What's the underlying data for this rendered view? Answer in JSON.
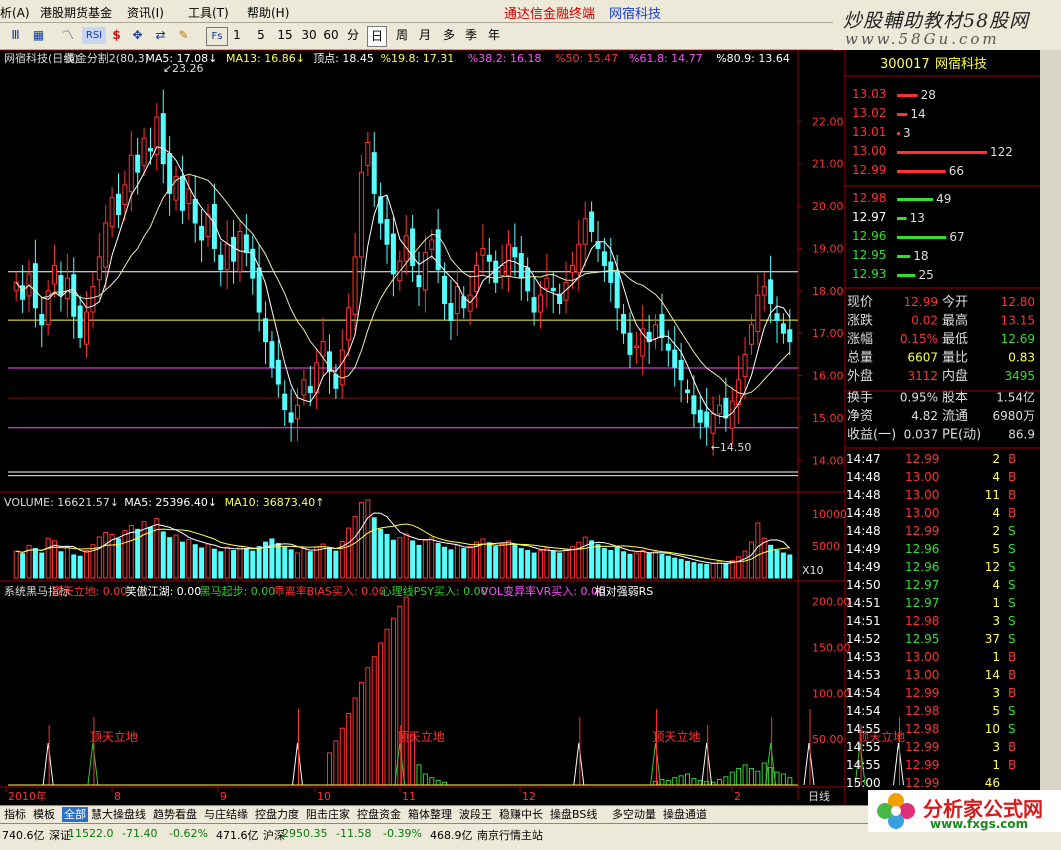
{
  "menu": [
    "析(A)",
    "港股期货基金",
    "资讯(I)",
    "工具(T)",
    "帮助(H)"
  ],
  "promo": {
    "broker": "通达信金融终端",
    "stock": "网宿科技"
  },
  "watermark": {
    "title": "炒股輔助教材58股网",
    "url": "www.58Gu.com"
  },
  "toolbar": {
    "icons": [
      "Ⅲ",
      "RSI",
      "$",
      "✥",
      "⇄",
      "✎",
      "Fs"
    ],
    "periods": [
      "1",
      "5",
      "15",
      "30",
      "60",
      "分"
    ],
    "period_tabs": [
      "日",
      "周",
      "月",
      "多",
      "季",
      "年"
    ],
    "selected_period": "日"
  },
  "main_header": {
    "name": "网宿科技(日线)",
    "indicator": "黄金分割2(80,3)",
    "ma5": "MA5: 17.08",
    "ma13": "MA13: 16.86",
    "peak": "顶点: 18.45",
    "levels": [
      "%19.8: 17.31",
      "%38.2: 16.18",
      "%50: 15.47",
      "%61.8: 14.77",
      "%80.9: 13.64"
    ],
    "high_label": "23.26",
    "low_label": "14.50"
  },
  "vol_header": {
    "volume": "VOLUME: 16621.57",
    "ma5": "MA5: 25396.40",
    "ma10": "MA10: 36873.40"
  },
  "ind_header": {
    "name": "系统黑马指标",
    "items": [
      "顶天立地: 0.00",
      "笑傲江湖: 0.00",
      "黑马起步: 0.00",
      "乖离率BIAS买入: 0.00",
      "心理线PSY买入: 0.00",
      "VOL变异率VR买入: 0.00",
      "相对强弱RS"
    ]
  },
  "signal_label": "顶天立地",
  "x_axis": [
    "2010年",
    "8",
    "9",
    "10",
    "11",
    "12",
    "2",
    "日线"
  ],
  "price_axis": [
    "22.00",
    "21.00",
    "20.00",
    "19.00",
    "18.00",
    "17.00",
    "16.00",
    "15.00",
    "14.00"
  ],
  "vol_axis": [
    "10000",
    "5000"
  ],
  "vol_unit": "X10",
  "ind_axis": [
    "200.00",
    "150.00",
    "100.00",
    "50.00"
  ],
  "quote": {
    "code": "300017",
    "name": "网宿科技",
    "asks": [
      {
        "price": "13.03",
        "vol": "28"
      },
      {
        "price": "13.02",
        "vol": "14"
      },
      {
        "price": "13.01",
        "vol": "3"
      },
      {
        "price": "13.00",
        "vol": "122"
      },
      {
        "price": "12.99",
        "vol": "66"
      }
    ],
    "bids": [
      {
        "price": "12.98",
        "vol": "49"
      },
      {
        "price": "12.97",
        "vol": "13"
      },
      {
        "price": "12.96",
        "vol": "67"
      },
      {
        "price": "12.95",
        "vol": "18"
      },
      {
        "price": "12.93",
        "vol": "25"
      }
    ],
    "stats": [
      {
        "l1": "现价",
        "v1": "12.99",
        "l2": "今开",
        "v2": "12.80"
      },
      {
        "l1": "涨跌",
        "v1": "0.02",
        "l2": "最高",
        "v2": "13.15"
      },
      {
        "l1": "涨幅",
        "v1": "0.15%",
        "l2": "最低",
        "v2": "12.69"
      },
      {
        "l1": "总量",
        "v1": "6607",
        "l2": "量比",
        "v2": "0.83"
      },
      {
        "l1": "外盘",
        "v1": "3112",
        "l2": "内盘",
        "v2": "3495"
      },
      {
        "l1": "换手",
        "v1": "0.95%",
        "l2": "股本",
        "v2": "1.54亿"
      },
      {
        "l1": "净资",
        "v1": "4.82",
        "l2": "流通",
        "v2": "6980万"
      },
      {
        "l1": "收益(一)",
        "v1": "0.037",
        "l2": "PE(动)",
        "v2": "86.9"
      }
    ],
    "ticks": [
      {
        "time": "14:47",
        "price": "12.99",
        "vol": "2",
        "bs": "B"
      },
      {
        "time": "14:48",
        "price": "13.00",
        "vol": "4",
        "bs": "B"
      },
      {
        "time": "14:48",
        "price": "13.00",
        "vol": "11",
        "bs": "B"
      },
      {
        "time": "14:48",
        "price": "13.00",
        "vol": "4",
        "bs": "B"
      },
      {
        "time": "14:48",
        "price": "12.99",
        "vol": "2",
        "bs": "S"
      },
      {
        "time": "14:49",
        "price": "12.96",
        "vol": "5",
        "bs": "S"
      },
      {
        "time": "14:49",
        "price": "12.96",
        "vol": "12",
        "bs": "S"
      },
      {
        "time": "14:50",
        "price": "12.97",
        "vol": "4",
        "bs": "S"
      },
      {
        "time": "14:51",
        "price": "12.97",
        "vol": "1",
        "bs": "S"
      },
      {
        "time": "14:51",
        "price": "12.98",
        "vol": "3",
        "bs": "S"
      },
      {
        "time": "14:52",
        "price": "12.95",
        "vol": "37",
        "bs": "S"
      },
      {
        "time": "14:53",
        "price": "13.00",
        "vol": "1",
        "bs": "B"
      },
      {
        "time": "14:53",
        "price": "13.00",
        "vol": "14",
        "bs": "B"
      },
      {
        "time": "14:54",
        "price": "12.99",
        "vol": "3",
        "bs": "B"
      },
      {
        "time": "14:54",
        "price": "12.98",
        "vol": "5",
        "bs": "S"
      },
      {
        "time": "14:55",
        "price": "12.98",
        "vol": "10",
        "bs": "S"
      },
      {
        "time": "14:55",
        "price": "12.99",
        "vol": "3",
        "bs": "B"
      },
      {
        "time": "14:55",
        "price": "12.99",
        "vol": "1",
        "bs": "B"
      },
      {
        "time": "15:00",
        "price": "12.99",
        "vol": "46",
        "bs": ""
      }
    ]
  },
  "bottom_tabs": [
    "指标",
    "模板",
    "全部",
    "慧大操盘线",
    "趋势看盘",
    "与庄结缘",
    "控盘力度",
    "阻击庄家",
    "控盘资金",
    "箱体整理",
    "波段王",
    "稳赚中长",
    "操盘BS线",
    "多空动量",
    "操盘通道"
  ],
  "selected_tab": "全部",
  "status": [
    {
      "text": "740.6亿",
      "color": "#000000"
    },
    {
      "text": "深证",
      "color": "#000000"
    },
    {
      "text": "11522.0",
      "color": "#0a7a0a"
    },
    {
      "text": "-71.40",
      "color": "#0a7a0a"
    },
    {
      "text": "-0.62%",
      "color": "#0a7a0a"
    },
    {
      "text": "471.6亿",
      "color": "#000000"
    },
    {
      "text": "沪深",
      "color": "#000000"
    },
    {
      "text": "2950.35",
      "color": "#0a7a0a"
    },
    {
      "text": "-11.58",
      "color": "#0a7a0a"
    },
    {
      "text": "-0.39%",
      "color": "#0a7a0a"
    },
    {
      "text": "468.9亿",
      "color": "#000000"
    },
    {
      "text": "南京行情主站",
      "color": "#000000"
    }
  ],
  "logo": {
    "title": "分析家公式网",
    "url": "www.fxgs.com"
  },
  "colors": {
    "up": "#ff3232",
    "down": "#54ffff",
    "gold": "#ffff50",
    "purple": "#ff50ff",
    "grid": "#a00000",
    "ma5": "#ffffff",
    "ma13": "#ffff00",
    "green": "#30d030"
  },
  "chart_data": [
    {
      "type": "candlestick",
      "title": "网宿科技(日线)",
      "x_labels": [
        "2010年",
        "8",
        "9",
        "10",
        "11",
        "12",
        "2"
      ],
      "ylim": [
        13.3,
        23.4
      ],
      "fib_levels": [
        18.45,
        17.31,
        16.18,
        15.47,
        14.77,
        13.64
      ],
      "marked_high": 23.26,
      "marked_low": 14.5,
      "closes": [
        18.2,
        17.8,
        18.4,
        17.6,
        17.2,
        18.0,
        18.6,
        17.9,
        18.3,
        17.4,
        16.9,
        17.5,
        18.1,
        18.8,
        19.6,
        20.2,
        19.8,
        20.5,
        21.2,
        20.8,
        21.6,
        21.3,
        22.1,
        21.0,
        20.3,
        20.7,
        19.9,
        20.4,
        19.6,
        19.2,
        19.8,
        19.0,
        18.5,
        19.1,
        18.7,
        19.4,
        18.9,
        18.3,
        17.5,
        16.8,
        16.2,
        15.8,
        15.2,
        14.9,
        15.3,
        15.9,
        15.6,
        16.3,
        16.8,
        16.1,
        15.7,
        16.6,
        17.6,
        18.8,
        20.8,
        21.5,
        20.3,
        19.6,
        19.1,
        18.4,
        18.7,
        19.3,
        18.6,
        18.1,
        18.9,
        19.2,
        18.5,
        17.7,
        17.3,
        18.1,
        17.6,
        17.9,
        18.6,
        19.0,
        18.7,
        18.2,
        18.6,
        19.1,
        18.8,
        18.3,
        18.0,
        17.5,
        17.9,
        18.3,
        18.0,
        17.7,
        18.2,
        18.6,
        19.1,
        19.7,
        19.4,
        19.0,
        18.6,
        18.2,
        17.6,
        17.0,
        16.5,
        16.7,
        17.1,
        16.8,
        17.2,
        16.9,
        16.6,
        16.2,
        15.9,
        15.6,
        15.1,
        14.9,
        14.8,
        15.1,
        15.3,
        15.0,
        15.4,
        15.9,
        16.5,
        17.2,
        17.9,
        18.1,
        17.7,
        17.3,
        17.0,
        16.8
      ]
    },
    {
      "type": "bar",
      "title": "VOLUME",
      "unit": "X10",
      "ylim": [
        0,
        12500
      ],
      "values": [
        4200,
        3800,
        5100,
        4600,
        3900,
        6200,
        5800,
        4100,
        4800,
        3600,
        3400,
        4300,
        5200,
        6400,
        7100,
        6800,
        6100,
        7400,
        8200,
        7600,
        8800,
        7900,
        9300,
        7200,
        6300,
        6700,
        5600,
        6000,
        5200,
        4700,
        5300,
        4500,
        4100,
        4800,
        4300,
        5000,
        4600,
        4200,
        4900,
        5600,
        6100,
        5400,
        4800,
        4400,
        3900,
        4600,
        4100,
        4800,
        5300,
        4600,
        4200,
        5700,
        7800,
        9600,
        11800,
        12200,
        9400,
        7600,
        6800,
        5900,
        6300,
        6900,
        5800,
        5100,
        5900,
        6300,
        5400,
        4800,
        4400,
        5100,
        4600,
        4900,
        5600,
        6100,
        5500,
        4900,
        5300,
        5800,
        5200,
        4600,
        4300,
        3900,
        4300,
        4700,
        4200,
        3900,
        4400,
        4900,
        5600,
        6400,
        5800,
        5200,
        4600,
        4300,
        4800,
        4100,
        3700,
        3900,
        4300,
        3800,
        4100,
        3700,
        3400,
        3100,
        2900,
        2600,
        2400,
        2200,
        2100,
        2300,
        2600,
        2200,
        2700,
        3300,
        4200,
        5600,
        8600,
        6200,
        5100,
        4300,
        3900,
        3600
      ]
    },
    {
      "type": "bar",
      "title": "系统黑马指标",
      "ylim": [
        0,
        215
      ],
      "values": [
        0,
        0,
        0,
        0,
        0,
        0,
        0,
        0,
        0,
        0,
        0,
        0,
        0,
        0,
        0,
        0,
        0,
        0,
        0,
        0,
        0,
        0,
        0,
        0,
        0,
        0,
        0,
        0,
        0,
        0,
        0,
        0,
        0,
        0,
        0,
        0,
        0,
        0,
        0,
        0,
        0,
        0,
        0,
        0,
        0,
        0,
        0,
        0,
        0,
        35,
        48,
        62,
        78,
        95,
        112,
        128,
        140,
        155,
        170,
        182,
        195,
        205,
        55,
        22,
        12,
        8,
        5,
        3,
        0,
        0,
        0,
        0,
        0,
        0,
        0,
        0,
        0,
        0,
        0,
        0,
        0,
        0,
        0,
        0,
        0,
        0,
        0,
        0,
        0,
        0,
        0,
        0,
        0,
        0,
        0,
        0,
        0,
        0,
        0,
        0,
        4,
        6,
        5,
        8,
        10,
        12,
        7,
        5,
        4,
        3,
        6,
        9,
        14,
        18,
        22,
        18,
        15,
        24,
        19,
        14,
        12,
        8
      ],
      "signal_x": [
        5,
        12,
        44,
        60,
        88,
        100,
        108,
        118,
        124,
        132,
        138
      ],
      "signal_labels_at": [
        12,
        60,
        100,
        132
      ]
    }
  ]
}
